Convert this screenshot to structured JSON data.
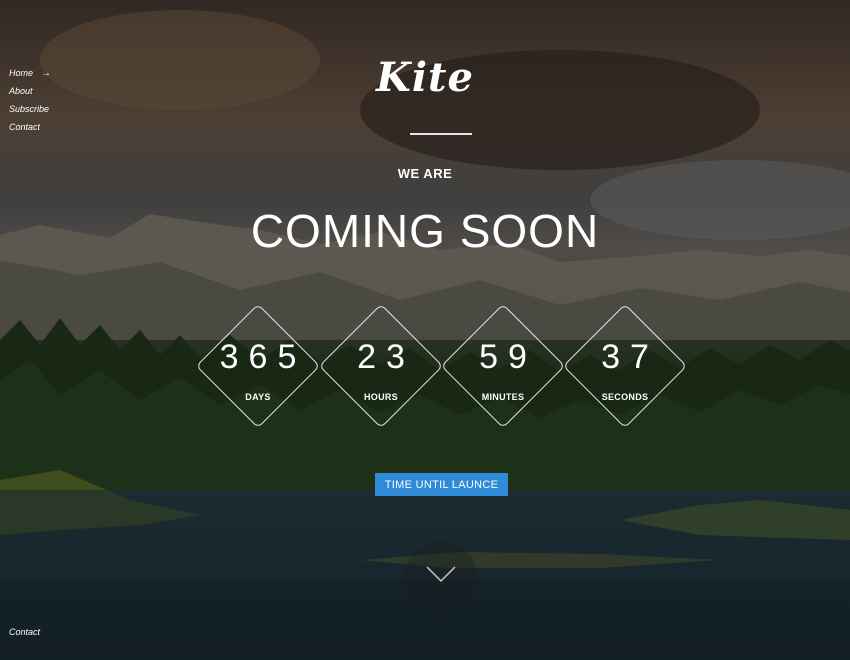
{
  "nav": {
    "items": [
      {
        "label": "Home",
        "active": true
      },
      {
        "label": "About"
      },
      {
        "label": "Subscribe"
      },
      {
        "label": "Contact"
      }
    ],
    "active_arrow": "→"
  },
  "hero": {
    "logo": "Kite",
    "eyebrow": "WE ARE",
    "headline": "COMING SOON"
  },
  "countdown": [
    {
      "value": "365",
      "label": "DAYS"
    },
    {
      "value": "23",
      "label": "HOURS"
    },
    {
      "value": "59",
      "label": "MINUTES"
    },
    {
      "value": "37",
      "label": "SECONDS"
    }
  ],
  "cta": {
    "label": "TIME UNTIL LAUNCE"
  },
  "footer": {
    "contact": "Contact"
  },
  "icons": {
    "scroll": "chevron-down-icon",
    "nav_active": "arrow-right-icon"
  },
  "colors": {
    "accent": "#2f8ad8",
    "text": "#ffffff"
  }
}
